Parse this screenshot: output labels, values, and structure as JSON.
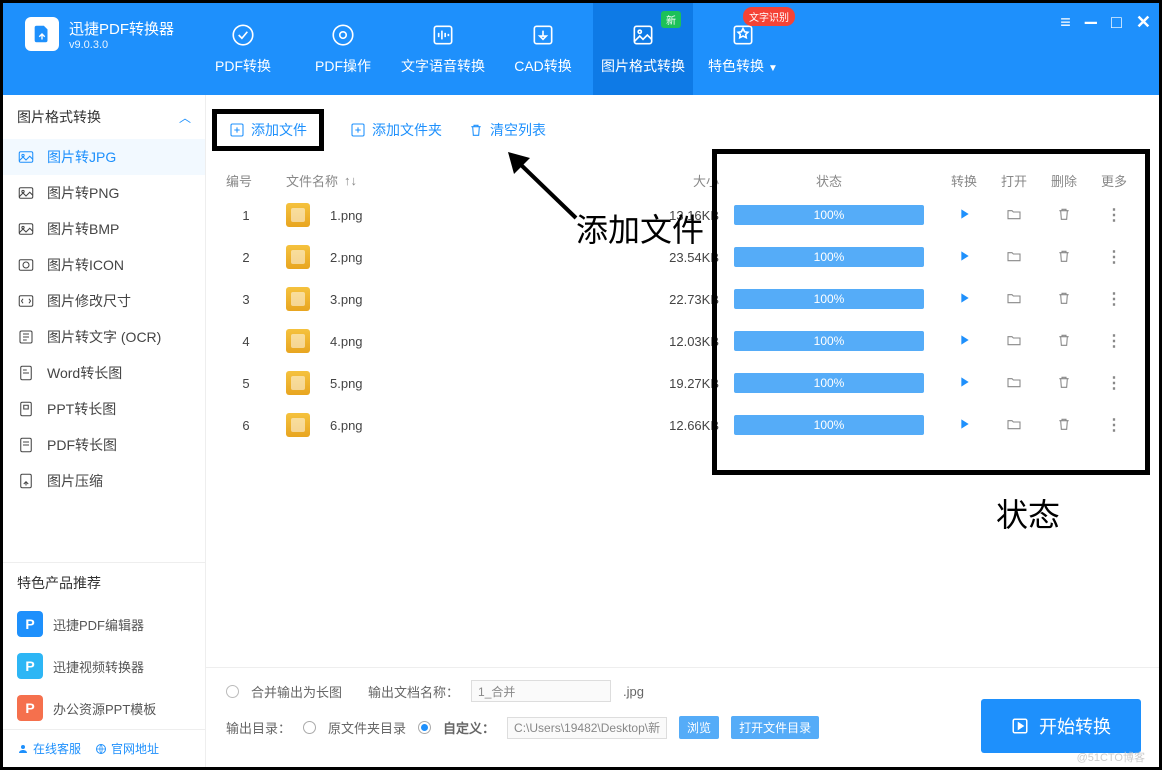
{
  "app": {
    "name": "迅捷PDF转换器",
    "version": "v9.0.3.0"
  },
  "top_tabs": [
    {
      "label": "PDF转换"
    },
    {
      "label": "PDF操作"
    },
    {
      "label": "文字语音转换"
    },
    {
      "label": "CAD转换"
    },
    {
      "label": "图片格式转换",
      "active": true,
      "badge_green": "新"
    },
    {
      "label": "特色转换",
      "dropdown": true,
      "badge_red": "文字识别"
    }
  ],
  "sidebar": {
    "header": "图片格式转换",
    "items": [
      "图片转JPG",
      "图片转PNG",
      "图片转BMP",
      "图片转ICON",
      "图片修改尺寸",
      "图片转文字 (OCR)",
      "Word转长图",
      "PPT转长图",
      "PDF转长图",
      "图片压缩"
    ],
    "active_index": 0,
    "promo_title": "特色产品推荐",
    "promos": [
      {
        "label": "迅捷PDF编辑器",
        "color": "#1E90FC"
      },
      {
        "label": "迅捷视频转换器",
        "color": "#2DB6F5"
      },
      {
        "label": "办公资源PPT模板",
        "color": "#F5704D"
      }
    ],
    "bottom": {
      "service": "在线客服",
      "site": "官网地址"
    }
  },
  "toolbar": {
    "add_file": "添加文件",
    "add_folder": "添加文件夹",
    "clear": "清空列表"
  },
  "columns": {
    "index": "编号",
    "name": "文件名称",
    "size": "大小",
    "status": "状态",
    "convert": "转换",
    "open": "打开",
    "delete": "删除",
    "more": "更多"
  },
  "rows": [
    {
      "idx": "1",
      "name": "1.png",
      "size": "13.16KB",
      "progress": "100%"
    },
    {
      "idx": "2",
      "name": "2.png",
      "size": "23.54KB",
      "progress": "100%"
    },
    {
      "idx": "3",
      "name": "3.png",
      "size": "22.73KB",
      "progress": "100%"
    },
    {
      "idx": "4",
      "name": "4.png",
      "size": "12.03KB",
      "progress": "100%"
    },
    {
      "idx": "5",
      "name": "5.png",
      "size": "19.27KB",
      "progress": "100%"
    },
    {
      "idx": "6",
      "name": "6.png",
      "size": "12.66KB",
      "progress": "100%"
    }
  ],
  "footer": {
    "merge_label": "合并输出为长图",
    "out_name_label": "输出文档名称：",
    "out_name_value": "1_合并",
    "out_ext": ".jpg",
    "out_dir_label": "输出目录：",
    "opt_same": "原文件夹目录",
    "opt_custom": "自定义：",
    "custom_path": "C:\\Users\\19482\\Desktop\\新",
    "browse": "浏览",
    "open_folder": "打开文件目录",
    "start": "开始转换"
  },
  "annotations": {
    "add_file_label": "添加文件",
    "status_label": "状态"
  },
  "watermark": "@51CTO博客"
}
